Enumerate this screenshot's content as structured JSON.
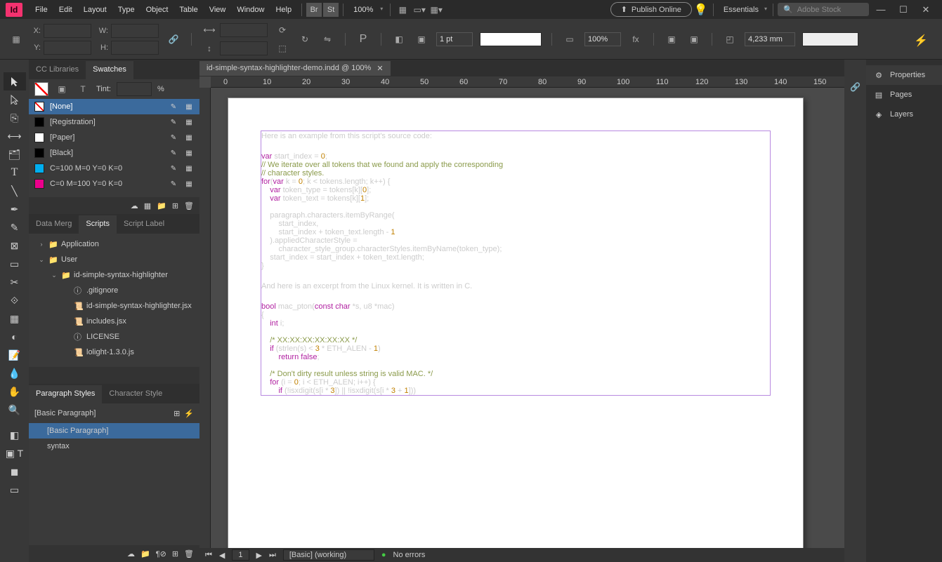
{
  "menu": {
    "items": [
      "File",
      "Edit",
      "Layout",
      "Type",
      "Object",
      "Table",
      "View",
      "Window",
      "Help"
    ],
    "zoom": "100%",
    "publish": "Publish Online",
    "workspace": "Essentials",
    "stock_placeholder": "Adobe Stock",
    "logo": "Id",
    "br": "Br",
    "st": "St"
  },
  "control": {
    "x_label": "X:",
    "y_label": "Y:",
    "w_label": "W:",
    "h_label": "H:",
    "stroke_weight": "1 pt",
    "scale": "100%",
    "offset": "4,233 mm"
  },
  "panels": {
    "swatches": {
      "tabs": [
        "CC Libraries",
        "Swatches"
      ],
      "active": 1,
      "tint_label": "Tint:",
      "tint_unit": "%",
      "items": [
        {
          "name": "[None]",
          "color": "#ffffff",
          "none": true,
          "sel": true
        },
        {
          "name": "[Registration]",
          "color": "#000000"
        },
        {
          "name": "[Paper]",
          "color": "#ffffff"
        },
        {
          "name": "[Black]",
          "color": "#000000"
        },
        {
          "name": "C=100 M=0 Y=0 K=0",
          "color": "#00aeef"
        },
        {
          "name": "C=0 M=100 Y=0 K=0",
          "color": "#ec008c"
        }
      ]
    },
    "scripts": {
      "tabs": [
        "Data Merg",
        "Scripts",
        "Script Label"
      ],
      "active": 1,
      "tree": [
        {
          "d": 0,
          "tw": ">",
          "ic": "📁",
          "label": "Application"
        },
        {
          "d": 0,
          "tw": "v",
          "ic": "📁",
          "label": "User"
        },
        {
          "d": 1,
          "tw": "v",
          "ic": "📁",
          "label": "id-simple-syntax-highlighter"
        },
        {
          "d": 2,
          "tw": "",
          "ic": "ⓘ",
          "label": ".gitignore"
        },
        {
          "d": 2,
          "tw": "",
          "ic": "📜",
          "label": "id-simple-syntax-highlighter.jsx"
        },
        {
          "d": 2,
          "tw": "",
          "ic": "📜",
          "label": "includes.jsx"
        },
        {
          "d": 2,
          "tw": "",
          "ic": "ⓘ",
          "label": "LICENSE"
        },
        {
          "d": 2,
          "tw": "",
          "ic": "📜",
          "label": "lolight-1.3.0.js"
        }
      ]
    },
    "para": {
      "tabs": [
        "Paragraph Styles",
        "Character Style"
      ],
      "active": 0,
      "header": "[Basic Paragraph]",
      "items": [
        {
          "name": "[Basic Paragraph]",
          "sel": true,
          "indent": 1
        },
        {
          "name": "syntax",
          "indent": 1
        }
      ]
    }
  },
  "document": {
    "tab": "id-simple-syntax-highlighter-demo.indd @ 100%",
    "ruler": [
      "0",
      "10",
      "20",
      "30",
      "40",
      "50",
      "60",
      "70",
      "80",
      "90",
      "100",
      "110",
      "120",
      "130",
      "140",
      "150"
    ],
    "intro": "Here is an example from this script's source code:",
    "mid": "And here is an excerpt from the Linux kernel. It is written in C.",
    "code1": [
      {
        "t": "",
        "p": [
          [
            "kw",
            "var"
          ],
          [
            "",
            " start_index = "
          ],
          [
            "num",
            "0"
          ],
          [
            "",
            ";"
          ]
        ]
      },
      {
        "t": "",
        "p": [
          [
            "cm",
            "// We iterate over all tokens that we found and apply the corresponding"
          ]
        ]
      },
      {
        "t": "",
        "p": [
          [
            "cm",
            "// character styles."
          ]
        ]
      },
      {
        "t": "",
        "p": [
          [
            "kw",
            "for"
          ],
          [
            "",
            "("
          ],
          [
            "kw",
            "var"
          ],
          [
            "",
            " k = "
          ],
          [
            "num",
            "0"
          ],
          [
            "",
            "; k < tokens.length; k++) {"
          ]
        ]
      },
      {
        "t": "    ",
        "p": [
          [
            "kw",
            "var"
          ],
          [
            "",
            " token_type = tokens[k]["
          ],
          [
            "num",
            "0"
          ],
          [
            "",
            "];"
          ]
        ]
      },
      {
        "t": "    ",
        "p": [
          [
            "kw",
            "var"
          ],
          [
            "",
            " token_text = tokens[k]["
          ],
          [
            "num",
            "1"
          ],
          [
            "",
            "];"
          ]
        ]
      },
      {
        "t": "",
        "p": [
          [
            "",
            ""
          ]
        ]
      },
      {
        "t": "    ",
        "p": [
          [
            "",
            "paragraph.characters.itemByRange("
          ]
        ]
      },
      {
        "t": "        ",
        "p": [
          [
            "",
            "start_index,"
          ]
        ]
      },
      {
        "t": "        ",
        "p": [
          [
            "",
            "start_index + token_text.length - "
          ],
          [
            "num",
            "1"
          ]
        ]
      },
      {
        "t": "    ",
        "p": [
          [
            "",
            ").appliedCharacterStyle ="
          ]
        ]
      },
      {
        "t": "        ",
        "p": [
          [
            "",
            "character_style_group.characterStyles.itemByName(token_type);"
          ]
        ]
      },
      {
        "t": "    ",
        "p": [
          [
            "",
            "start_index = start_index + token_text.length;"
          ]
        ]
      },
      {
        "t": "",
        "p": [
          [
            "",
            "}"
          ]
        ]
      }
    ],
    "code2": [
      {
        "t": "",
        "p": [
          [
            "kw",
            "bool"
          ],
          [
            "",
            " mac_pton("
          ],
          [
            "kw",
            "const"
          ],
          [
            "",
            " "
          ],
          [
            "kw",
            "char"
          ],
          [
            "",
            " *s, u8 *mac)"
          ]
        ]
      },
      {
        "t": "",
        "p": [
          [
            "",
            "{"
          ]
        ]
      },
      {
        "t": "    ",
        "p": [
          [
            "kw",
            "int"
          ],
          [
            "",
            " i;"
          ]
        ]
      },
      {
        "t": "",
        "p": [
          [
            "",
            ""
          ]
        ]
      },
      {
        "t": "    ",
        "p": [
          [
            "cm",
            "/* XX:XX:XX:XX:XX:XX */"
          ]
        ]
      },
      {
        "t": "    ",
        "p": [
          [
            "kw",
            "if"
          ],
          [
            "",
            " (strlen(s) < "
          ],
          [
            "num",
            "3"
          ],
          [
            "",
            " * ETH_ALEN - "
          ],
          [
            "num",
            "1"
          ],
          [
            "",
            ")"
          ]
        ]
      },
      {
        "t": "        ",
        "p": [
          [
            "kw",
            "return"
          ],
          [
            "",
            " "
          ],
          [
            "kw",
            "false"
          ],
          [
            "",
            ";"
          ]
        ]
      },
      {
        "t": "",
        "p": [
          [
            "",
            ""
          ]
        ]
      },
      {
        "t": "    ",
        "p": [
          [
            "cm",
            "/* Don't dirty result unless string is valid MAC. */"
          ]
        ]
      },
      {
        "t": "    ",
        "p": [
          [
            "kw",
            "for"
          ],
          [
            "",
            " (i = "
          ],
          [
            "num",
            "0"
          ],
          [
            "",
            "; i < ETH_ALEN; i++) {"
          ]
        ]
      },
      {
        "t": "        ",
        "p": [
          [
            "kw",
            "if"
          ],
          [
            "",
            " (!isxdigit(s[i * "
          ],
          [
            "num",
            "3"
          ],
          [
            "",
            "]) || !isxdigit(s[i * "
          ],
          [
            "num",
            "3"
          ],
          [
            "",
            " + "
          ],
          [
            "num",
            "1"
          ],
          [
            "",
            "]))"
          ]
        ]
      }
    ]
  },
  "status": {
    "page": "1",
    "preset": "[Basic] (working)",
    "errors": "No errors"
  },
  "right": {
    "items": [
      "Properties",
      "Pages",
      "Layers"
    ],
    "active": 0,
    "link_icon": "🔗"
  }
}
